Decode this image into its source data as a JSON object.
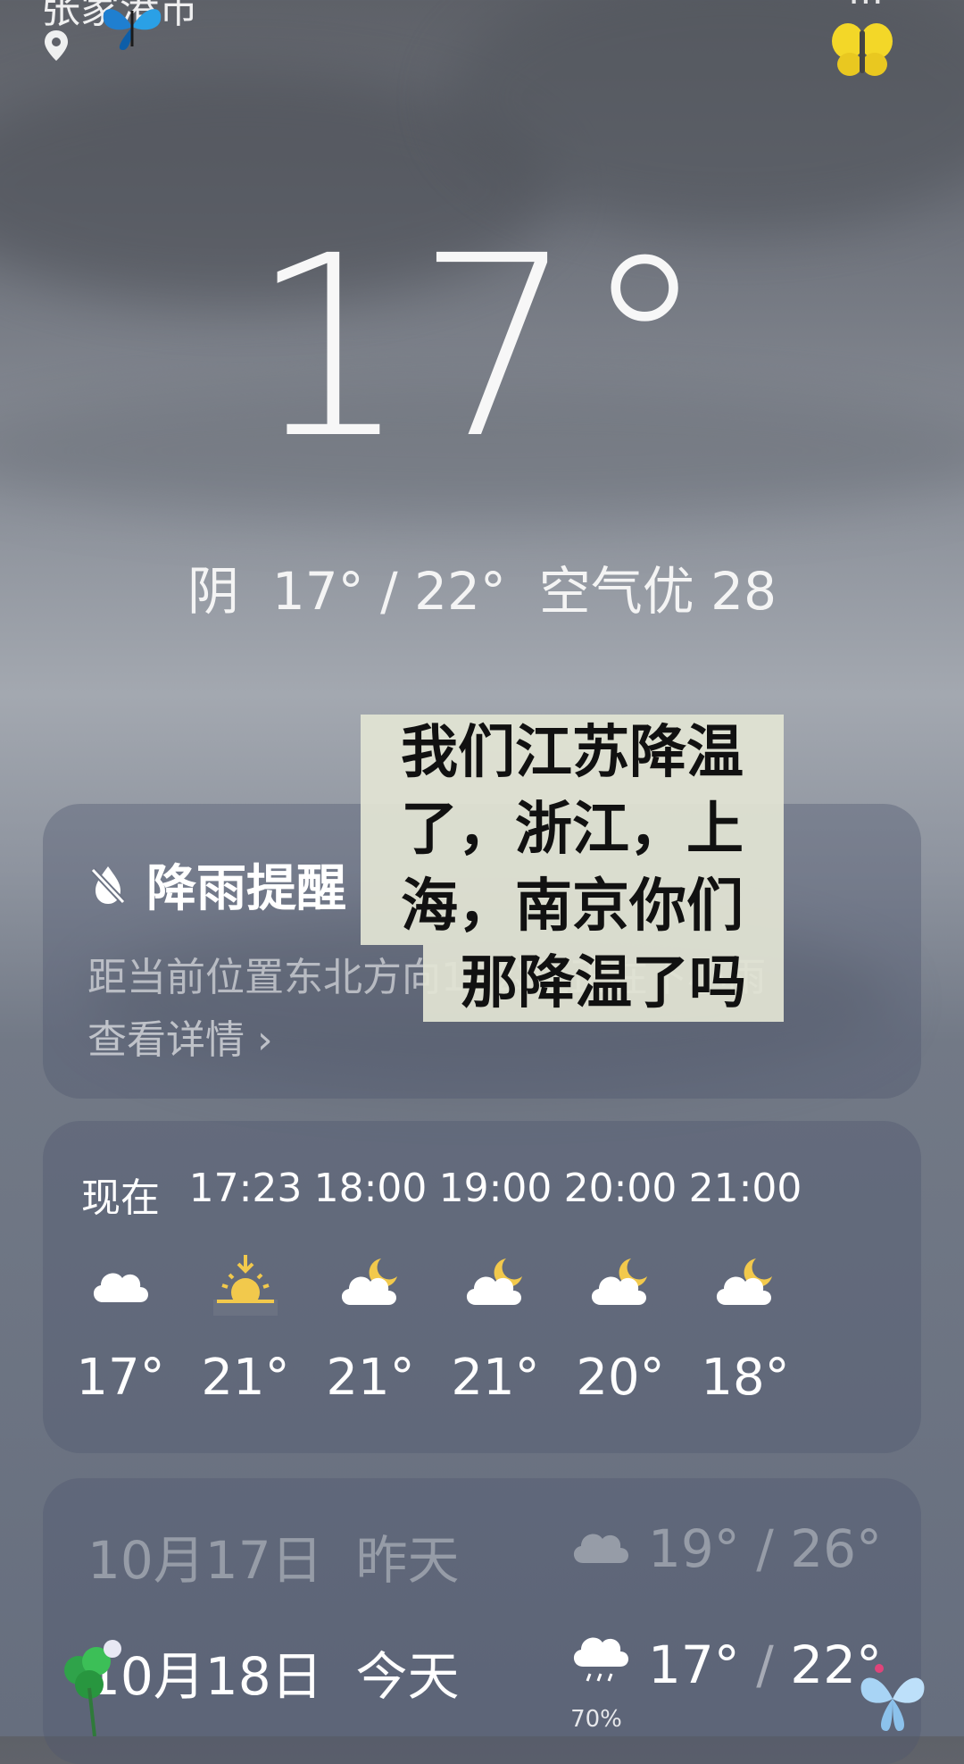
{
  "location": {
    "city_partial": "张家港市",
    "top_right_partial": "⋯"
  },
  "current": {
    "temperature": "17°",
    "summary": "阴  17° / 22°  空气优 28"
  },
  "rain_alert": {
    "title": "降雨提醒",
    "description": "距当前位置东北方向10公里正在下小雨",
    "link": "查看详情 ›"
  },
  "overlay_caption": {
    "lines": [
      "我们江苏降温",
      "了，浙江，上",
      "海，南京你们",
      "那降温了吗"
    ]
  },
  "hourly": [
    {
      "time": "现在",
      "icon": "cloud-icon",
      "temp": "17°"
    },
    {
      "time": "17:23",
      "icon": "sunset-icon",
      "temp": "21°"
    },
    {
      "time": "18:00",
      "icon": "cloud-moon-icon",
      "temp": "21°"
    },
    {
      "time": "19:00",
      "icon": "cloud-moon-icon",
      "temp": "21°"
    },
    {
      "time": "20:00",
      "icon": "cloud-moon-icon",
      "temp": "20°"
    },
    {
      "time": "21:00",
      "icon": "cloud-moon-icon",
      "temp": "18°"
    }
  ],
  "daily": [
    {
      "date": "10月17日  昨天",
      "icon": "cloud-icon",
      "precip": "",
      "low": "19°",
      "high": "26°"
    },
    {
      "date": "10月18日  今天",
      "icon": "rain-cloud-icon",
      "precip": "70%",
      "low": "17°",
      "high": "22°"
    }
  ],
  "colors": {
    "sun": "#f2c94c",
    "moon": "#f2c94c"
  }
}
